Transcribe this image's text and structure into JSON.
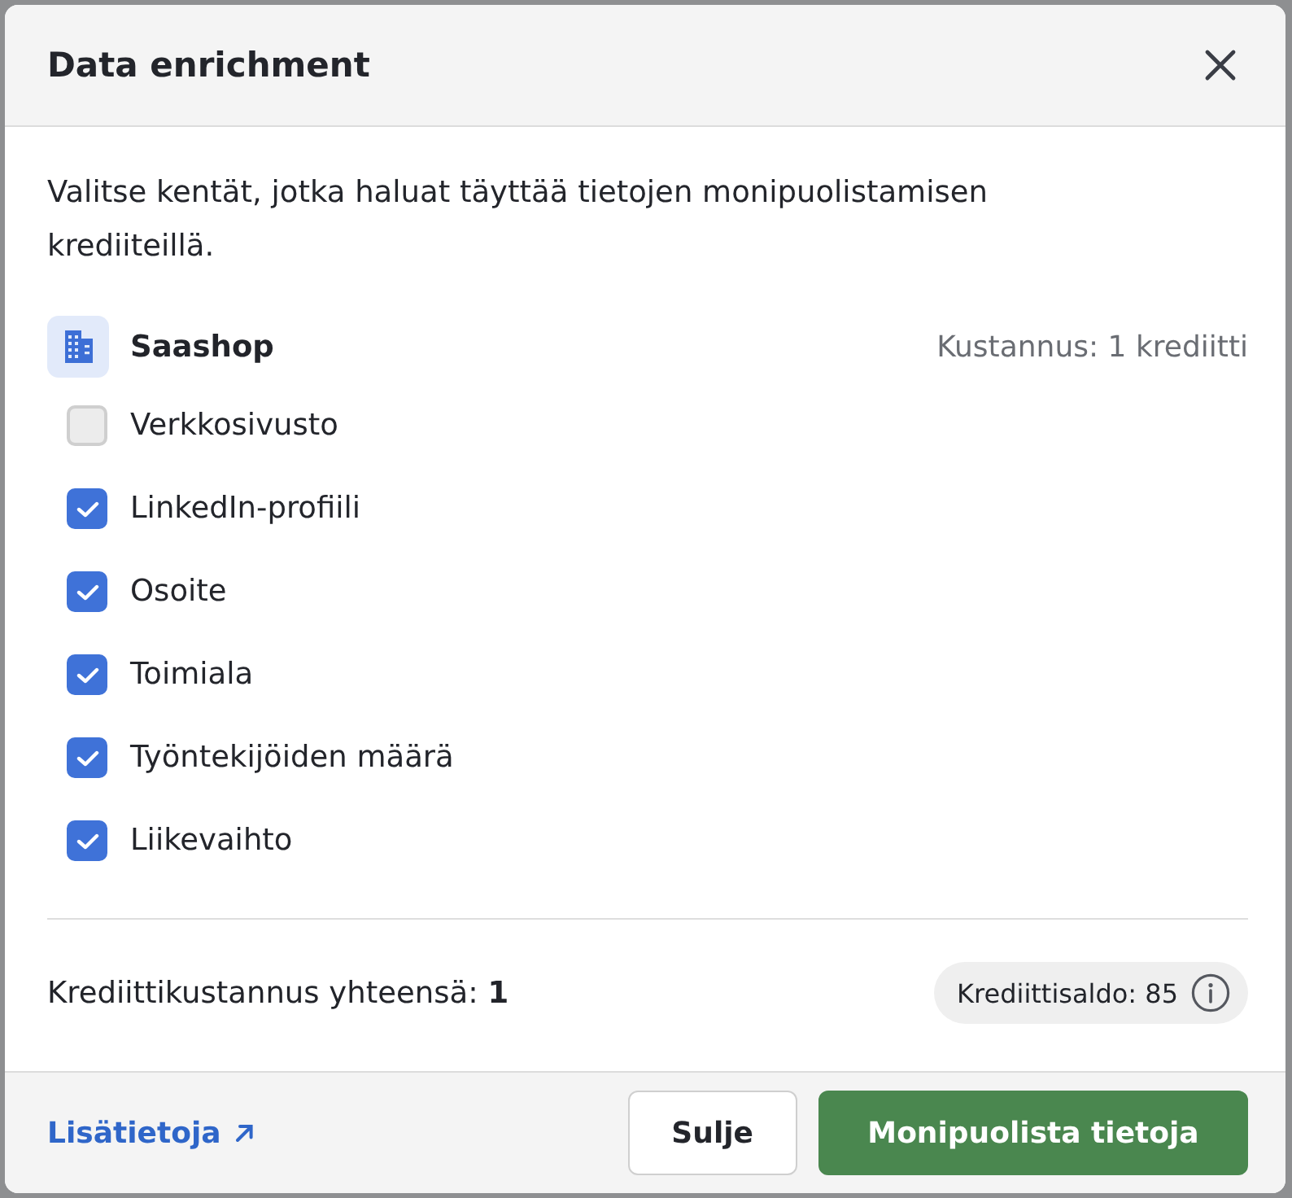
{
  "dialog": {
    "title": "Data enrichment",
    "description": "Valitse kentät, jotka haluat täyttää tietojen monipuolistamisen krediiteillä.",
    "company": {
      "name": "Saashop",
      "cost": "Kustannus: 1 krediitti"
    },
    "fields": [
      {
        "label": "Verkkosivusto",
        "checked": false
      },
      {
        "label": "LinkedIn-profiili",
        "checked": true
      },
      {
        "label": "Osoite",
        "checked": true
      },
      {
        "label": "Toimiala",
        "checked": true
      },
      {
        "label": "Työntekijöiden määrä",
        "checked": true
      },
      {
        "label": "Liikevaihto",
        "checked": true
      }
    ],
    "total": "Krediittikustannus yhteensä: **1**",
    "balance": "Krediittisaldo: 85",
    "footer": {
      "link": "Lisätietoja",
      "buttons": [
        {
          "label": "Sulje",
          "kind": "secondary"
        },
        {
          "label": "Monipuolista tietoja",
          "kind": "primary"
        }
      ]
    }
  }
}
